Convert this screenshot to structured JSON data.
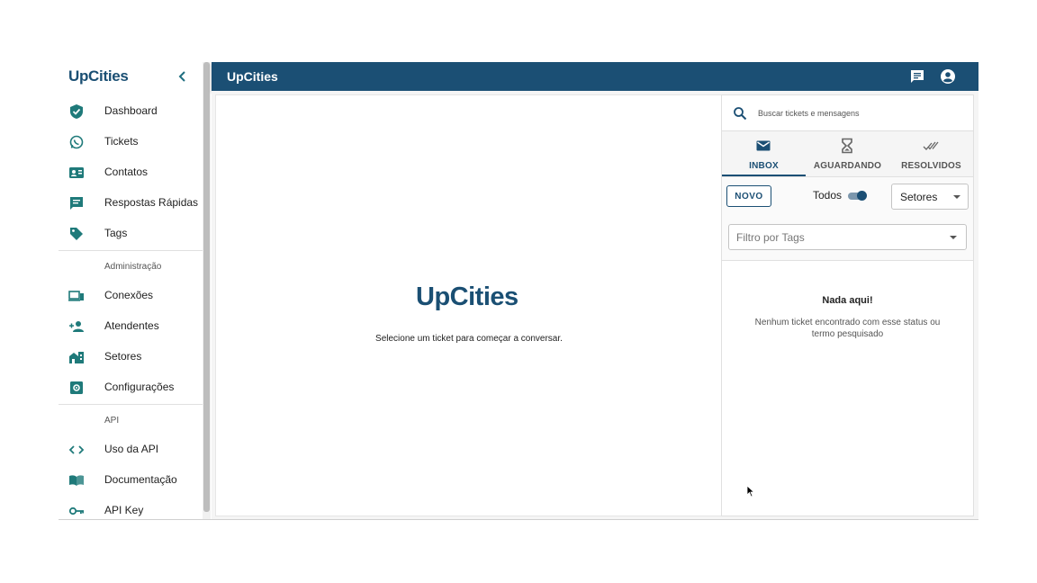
{
  "sidebar": {
    "logo": "UpCities",
    "items": [
      {
        "label": "Dashboard",
        "icon": "shield-check-icon"
      },
      {
        "label": "Tickets",
        "icon": "whatsapp-icon"
      },
      {
        "label": "Contatos",
        "icon": "contact-card-icon"
      },
      {
        "label": "Respostas Rápidas",
        "icon": "quick-reply-icon"
      },
      {
        "label": "Tags",
        "icon": "tag-icon"
      }
    ],
    "section_admin": "Administração",
    "admin_items": [
      {
        "label": "Conexões",
        "icon": "devices-icon"
      },
      {
        "label": "Atendentes",
        "icon": "add-person-icon"
      },
      {
        "label": "Setores",
        "icon": "building-icon"
      },
      {
        "label": "Configurações",
        "icon": "settings-icon"
      }
    ],
    "section_api": "API",
    "api_items": [
      {
        "label": "Uso da API",
        "icon": "code-icon"
      },
      {
        "label": "Documentação",
        "icon": "book-icon"
      },
      {
        "label": "API Key",
        "icon": "key-icon"
      }
    ]
  },
  "header": {
    "title": "UpCities"
  },
  "chat": {
    "logo": "UpCities",
    "placeholder_text": "Selecione um ticket para começar a conversar."
  },
  "tickets": {
    "search_placeholder": "Buscar tickets e mensagens",
    "tabs": [
      {
        "label": "INBOX",
        "icon": "mail-icon",
        "active": true
      },
      {
        "label": "AGUARDANDO",
        "icon": "hourglass-icon",
        "active": false
      },
      {
        "label": "RESOLVIDOS",
        "icon": "done-all-icon",
        "active": false
      }
    ],
    "new_button": "NOVO",
    "toggle_label": "Todos",
    "toggle_on": true,
    "sector_select": "Setores",
    "tag_filter_placeholder": "Filtro por Tags",
    "empty_title": "Nada aqui!",
    "empty_text": "Nenhum ticket encontrado com esse status ou termo pesquisado"
  },
  "colors": {
    "primary": "#1b4f74",
    "accent": "#1f7a7a"
  }
}
